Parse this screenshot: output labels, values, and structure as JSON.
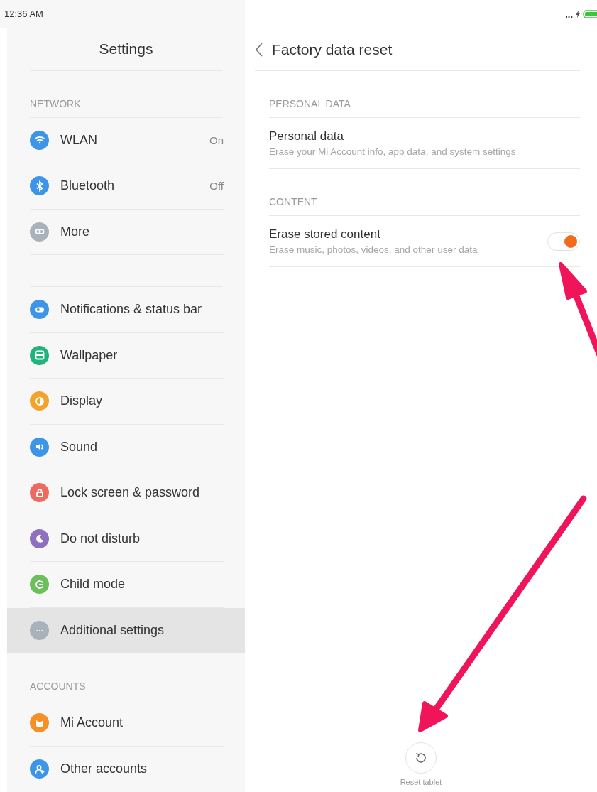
{
  "status_bar": {
    "time": "12:36 AM",
    "more": "..."
  },
  "sidebar": {
    "title": "Settings",
    "groups": [
      {
        "header": "NETWORK",
        "items": [
          {
            "label": "WLAN",
            "value": "On",
            "color": "#3d95e8",
            "selected": false
          },
          {
            "label": "Bluetooth",
            "value": "Off",
            "color": "#3d95e8",
            "selected": false
          },
          {
            "label": "More",
            "color": "#a9b1bb",
            "selected": false
          }
        ]
      },
      {
        "items": [
          {
            "label": "Notifications & status bar",
            "color": "#3d95e8",
            "selected": false
          },
          {
            "label": "Wallpaper",
            "color": "#1fb37e",
            "selected": false
          },
          {
            "label": "Display",
            "color": "#f3a22c",
            "selected": false
          },
          {
            "label": "Sound",
            "color": "#3d95e8",
            "selected": false
          },
          {
            "label": "Lock screen & password",
            "color": "#ec6b5e",
            "selected": false
          },
          {
            "label": "Do not disturb",
            "color": "#8e70c0",
            "selected": false
          },
          {
            "label": "Child mode",
            "color": "#6cbf5a",
            "selected": false
          },
          {
            "label": "Additional settings",
            "color": "#a9b1bb",
            "selected": true
          }
        ]
      },
      {
        "header": "ACCOUNTS",
        "items": [
          {
            "label": "Mi Account",
            "color": "#f39127",
            "selected": false
          },
          {
            "label": "Other accounts",
            "color": "#3d95e8",
            "selected": false
          }
        ]
      }
    ]
  },
  "detail": {
    "title": "Factory data reset",
    "sections": [
      {
        "header": "PERSONAL DATA",
        "items": [
          {
            "title": "Personal data",
            "subtitle": "Erase your Mi Account info, app data, and system settings",
            "kind": "link"
          }
        ]
      },
      {
        "header": "CONTENT",
        "items": [
          {
            "title": "Erase stored content",
            "subtitle": "Erase music, photos, videos, and other user data",
            "kind": "toggle",
            "on": true
          }
        ]
      }
    ],
    "reset_button": {
      "label": "Reset tablet"
    }
  }
}
